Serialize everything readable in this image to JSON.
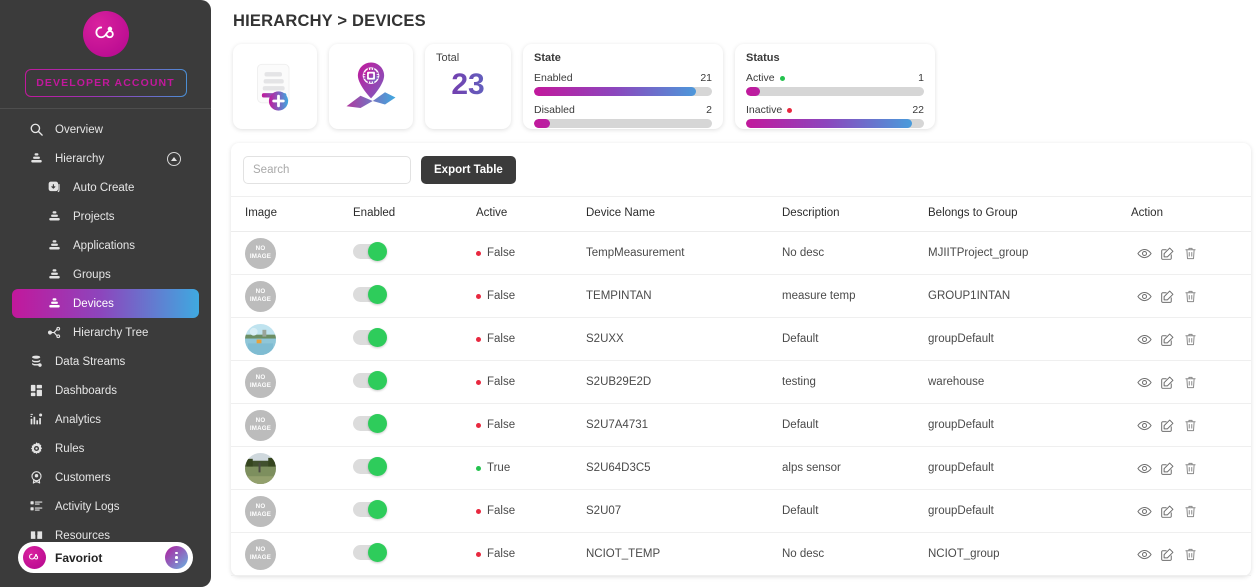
{
  "sidebar": {
    "brand_logo_icon": "favoriot-infinity-logo",
    "account_badge": "DEVELOPER ACCOUNT",
    "items": [
      {
        "label": "Overview",
        "icon": "search-icon",
        "level": "top",
        "active": false,
        "collapse": false
      },
      {
        "label": "Hierarchy",
        "icon": "hierarchy-icon",
        "level": "top",
        "active": false,
        "collapse": true
      },
      {
        "label": "Auto Create",
        "icon": "auto-create-icon",
        "level": "sub",
        "active": false,
        "collapse": false
      },
      {
        "label": "Projects",
        "icon": "hierarchy-icon",
        "level": "sub",
        "active": false,
        "collapse": false
      },
      {
        "label": "Applications",
        "icon": "hierarchy-icon",
        "level": "sub",
        "active": false,
        "collapse": false
      },
      {
        "label": "Groups",
        "icon": "hierarchy-icon",
        "level": "sub",
        "active": false,
        "collapse": false
      },
      {
        "label": "Devices",
        "icon": "hierarchy-icon",
        "level": "sub",
        "active": true,
        "collapse": false
      },
      {
        "label": "Hierarchy Tree",
        "icon": "tree-icon",
        "level": "sub",
        "active": false,
        "collapse": false
      },
      {
        "label": "Data Streams",
        "icon": "database-icon",
        "level": "top",
        "active": false,
        "collapse": false
      },
      {
        "label": "Dashboards",
        "icon": "dashboard-icon",
        "level": "top",
        "active": false,
        "collapse": false
      },
      {
        "label": "Analytics",
        "icon": "analytics-icon",
        "level": "top",
        "active": false,
        "collapse": false
      },
      {
        "label": "Rules",
        "icon": "gear-icon",
        "level": "top",
        "active": false,
        "collapse": false
      },
      {
        "label": "Customers",
        "icon": "customers-icon",
        "level": "top",
        "active": false,
        "collapse": false
      },
      {
        "label": "Activity Logs",
        "icon": "activity-logs-icon",
        "level": "top",
        "active": false,
        "collapse": false
      },
      {
        "label": "Resources",
        "icon": "resources-icon",
        "level": "top",
        "active": false,
        "collapse": false
      }
    ],
    "user": {
      "name": "Favoriot",
      "avatar_icon": "favoriot-infinity-logo",
      "more_icon": "dots-vertical-icon"
    }
  },
  "header": {
    "title": "HIERARCHY > DEVICES"
  },
  "cards": {
    "add_device": {
      "icon": "add-document-icon"
    },
    "map_device": {
      "icon": "map-pin-chip-icon"
    },
    "total": {
      "title": "Total",
      "value": "23"
    },
    "state": {
      "title": "State",
      "rows": [
        {
          "label": "Enabled",
          "value": "21",
          "percent": 91,
          "dot": ""
        },
        {
          "label": "Disabled",
          "value": "2",
          "percent": 9,
          "dot": ""
        }
      ]
    },
    "status": {
      "title": "Status",
      "rows": [
        {
          "label": "Active",
          "value": "1",
          "percent": 8,
          "dot": "#24c24e"
        },
        {
          "label": "Inactive",
          "value": "22",
          "percent": 93,
          "dot": "#e8283f"
        }
      ]
    }
  },
  "toolbar": {
    "search_placeholder": "Search",
    "search_value": "",
    "export_label": "Export Table"
  },
  "table": {
    "columns": [
      "Image",
      "Enabled",
      "Active",
      "Device Name",
      "Description",
      "Belongs to Group",
      "Action"
    ],
    "action_icons": [
      "eye-icon",
      "edit-icon",
      "trash-icon"
    ],
    "rows": [
      {
        "image": "NO IMAGE",
        "has_photo": false,
        "photo": "",
        "enabled": true,
        "active": "False",
        "name": "TempMeasurement",
        "description": "No desc",
        "group": "MJIITProject_group",
        "highlighted": true
      },
      {
        "image": "NO IMAGE",
        "has_photo": false,
        "photo": "",
        "enabled": true,
        "active": "False",
        "name": "TEMPINTAN",
        "description": "measure temp",
        "group": "GROUP1INTAN",
        "highlighted": false
      },
      {
        "image": "",
        "has_photo": true,
        "photo": "harbor",
        "enabled": true,
        "active": "False",
        "name": "S2UXX",
        "description": "Default",
        "group": "groupDefault",
        "highlighted": false
      },
      {
        "image": "NO IMAGE",
        "has_photo": false,
        "photo": "",
        "enabled": true,
        "active": "False",
        "name": "S2UB29E2D",
        "description": "testing",
        "group": "warehouse",
        "highlighted": false
      },
      {
        "image": "NO IMAGE",
        "has_photo": false,
        "photo": "",
        "enabled": true,
        "active": "False",
        "name": "S2U7A4731",
        "description": "Default",
        "group": "groupDefault",
        "highlighted": false
      },
      {
        "image": "",
        "has_photo": true,
        "photo": "park",
        "enabled": true,
        "active": "True",
        "name": "S2U64D3C5",
        "description": "alps sensor",
        "group": "groupDefault",
        "highlighted": false
      },
      {
        "image": "NO IMAGE",
        "has_photo": false,
        "photo": "",
        "enabled": true,
        "active": "False",
        "name": "S2U07",
        "description": "Default",
        "group": "groupDefault",
        "highlighted": false
      },
      {
        "image": "NO IMAGE",
        "has_photo": false,
        "photo": "",
        "enabled": true,
        "active": "False",
        "name": "NCIOT_TEMP",
        "description": "No desc",
        "group": "NCIOT_group",
        "highlighted": false
      }
    ]
  },
  "colors": {
    "accent_magenta": "#C2189C",
    "accent_blue": "#3FA9E0",
    "sidebar_bg": "#3B3B3B",
    "true_green": "#24C24E",
    "false_red": "#E8283F",
    "toggle_on": "#2ECC5B"
  }
}
